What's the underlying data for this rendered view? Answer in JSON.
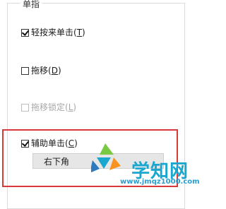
{
  "group": {
    "title": "单指"
  },
  "options": [
    {
      "pre": "轻按来单击(",
      "key": "T",
      "post": ")",
      "checked": true,
      "disabled": false
    },
    {
      "pre": "拖移(",
      "key": "D",
      "post": ")",
      "checked": false,
      "disabled": false
    },
    {
      "pre": "拖移锁定(",
      "key": "L",
      "post": ")",
      "checked": false,
      "disabled": true
    },
    {
      "pre": "辅助单击(",
      "key": "C",
      "post": ")",
      "checked": true,
      "disabled": false
    }
  ],
  "dropdown": {
    "selected": "右下角"
  },
  "watermark": {
    "brand": "学知网",
    "url": "www.jmqz1000.com"
  },
  "colors": {
    "highlight": "#d9393b",
    "watermark": "#1aa7cf"
  }
}
